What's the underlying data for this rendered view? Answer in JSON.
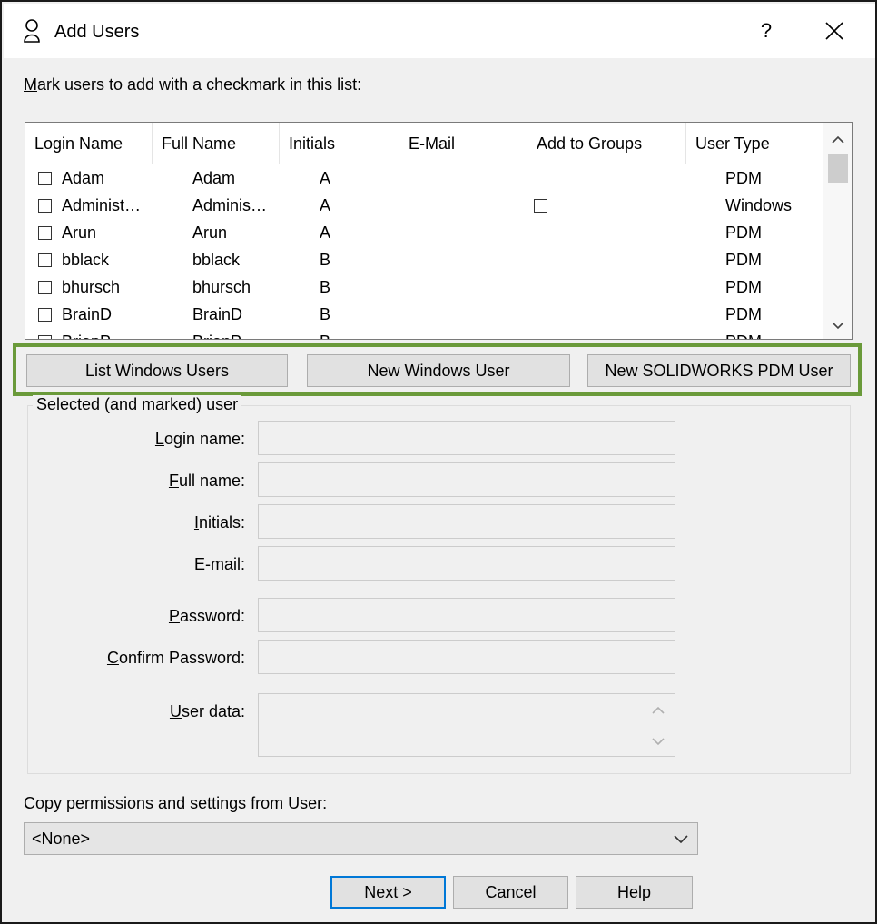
{
  "window": {
    "title": "Add Users",
    "help_glyph": "?",
    "close_glyph": "✕",
    "app_icon": "user-icon"
  },
  "instructions": {
    "accel": "M",
    "rest": "ark users to add with a checkmark in this list:"
  },
  "user_list": {
    "columns": [
      "Login Name",
      "Full Name",
      "Initials",
      "E-Mail",
      "Add to Groups",
      "User Type"
    ],
    "rows": [
      {
        "login": "Adam",
        "full": "Adam",
        "initials": "A",
        "email": "",
        "group_checkbox": false,
        "type": "PDM"
      },
      {
        "login": "Administ…",
        "full": "Adminis…",
        "initials": "A",
        "email": "",
        "group_checkbox": true,
        "type": "Windows"
      },
      {
        "login": "Arun",
        "full": "Arun",
        "initials": "A",
        "email": "",
        "group_checkbox": false,
        "type": "PDM"
      },
      {
        "login": "bblack",
        "full": "bblack",
        "initials": "B",
        "email": "",
        "group_checkbox": false,
        "type": "PDM"
      },
      {
        "login": "bhursch",
        "full": "bhursch",
        "initials": "B",
        "email": "",
        "group_checkbox": false,
        "type": "PDM"
      },
      {
        "login": "BrainD",
        "full": "BrainD",
        "initials": "B",
        "email": "",
        "group_checkbox": false,
        "type": "PDM"
      },
      {
        "login": "BrianP",
        "full": "BrianP",
        "initials": "B",
        "email": "",
        "group_checkbox": false,
        "type": "PDM"
      }
    ]
  },
  "action_buttons": {
    "list_windows": "List Windows Users",
    "new_windows": "New Windows User",
    "new_pdm": "New SOLIDWORKS PDM User"
  },
  "selected_group": {
    "label": "Selected (and marked) user",
    "login": {
      "accel": "L",
      "rest": "ogin name:",
      "value": ""
    },
    "full": {
      "accel": "F",
      "rest": "ull name:",
      "value": ""
    },
    "initials": {
      "accel": "I",
      "rest": "nitials:",
      "value": ""
    },
    "email": {
      "accel": "E",
      "rest": "-mail:",
      "value": ""
    },
    "password": {
      "accel": "P",
      "rest": "assword:",
      "value": ""
    },
    "confirm": {
      "accel": "C",
      "rest": "onfirm Password:",
      "value": ""
    },
    "userdata": {
      "accel": "U",
      "rest": "ser data:",
      "value": ""
    }
  },
  "copy_from": {
    "pre": "Copy permissions and ",
    "accel": "s",
    "post": "ettings from User:",
    "selected": "<None>"
  },
  "footer": {
    "next": "Next >",
    "cancel": "Cancel",
    "help": "Help"
  },
  "colors": {
    "highlight_border": "#6a9a3a",
    "default_button_border": "#0078d7"
  }
}
